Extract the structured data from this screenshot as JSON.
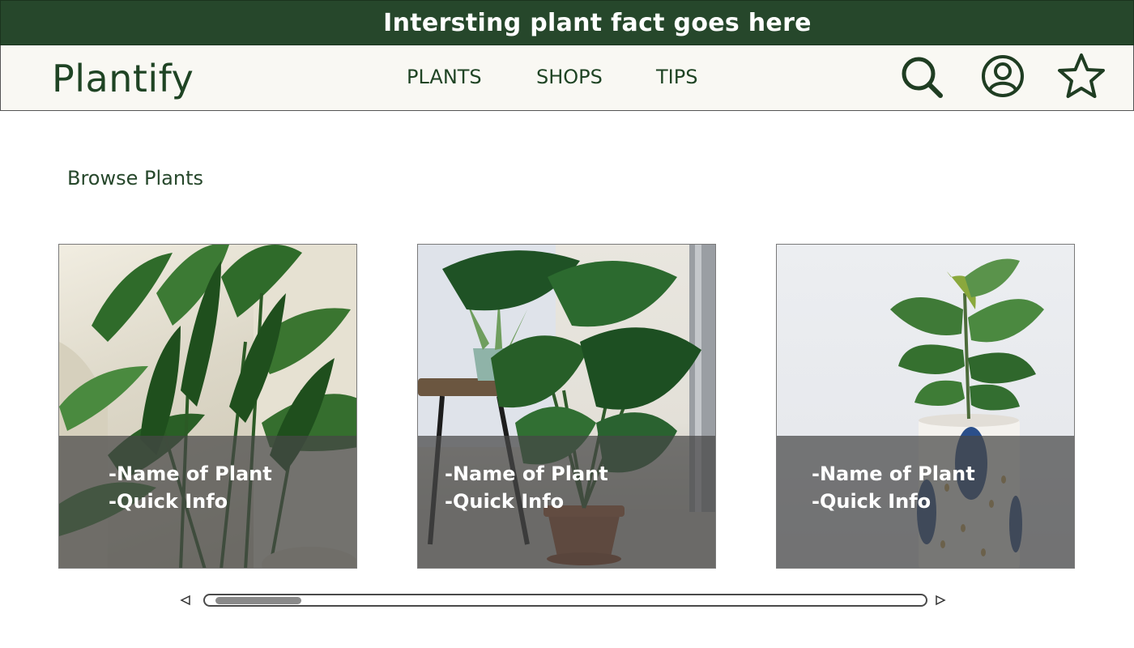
{
  "banner": {
    "fact": "Intersting plant fact goes here"
  },
  "header": {
    "logo": "Plantify",
    "nav": [
      "PLANTS",
      "SHOPS",
      "TIPS"
    ],
    "icons": [
      "search-icon",
      "user-icon",
      "star-icon"
    ]
  },
  "main": {
    "title": "Browse Plants",
    "cards": [
      {
        "name": "-Name of Plant",
        "info": "-Quick Info"
      },
      {
        "name": "-Name of Plant",
        "info": "-Quick Info"
      },
      {
        "name": "-Name of Plant",
        "info": "-Quick Info"
      }
    ],
    "carousel": {
      "scroll_position": 0.02
    }
  },
  "colors": {
    "brand_dark": "#26472b",
    "nav_bg": "#f9f8f3",
    "overlay": "#464646"
  }
}
